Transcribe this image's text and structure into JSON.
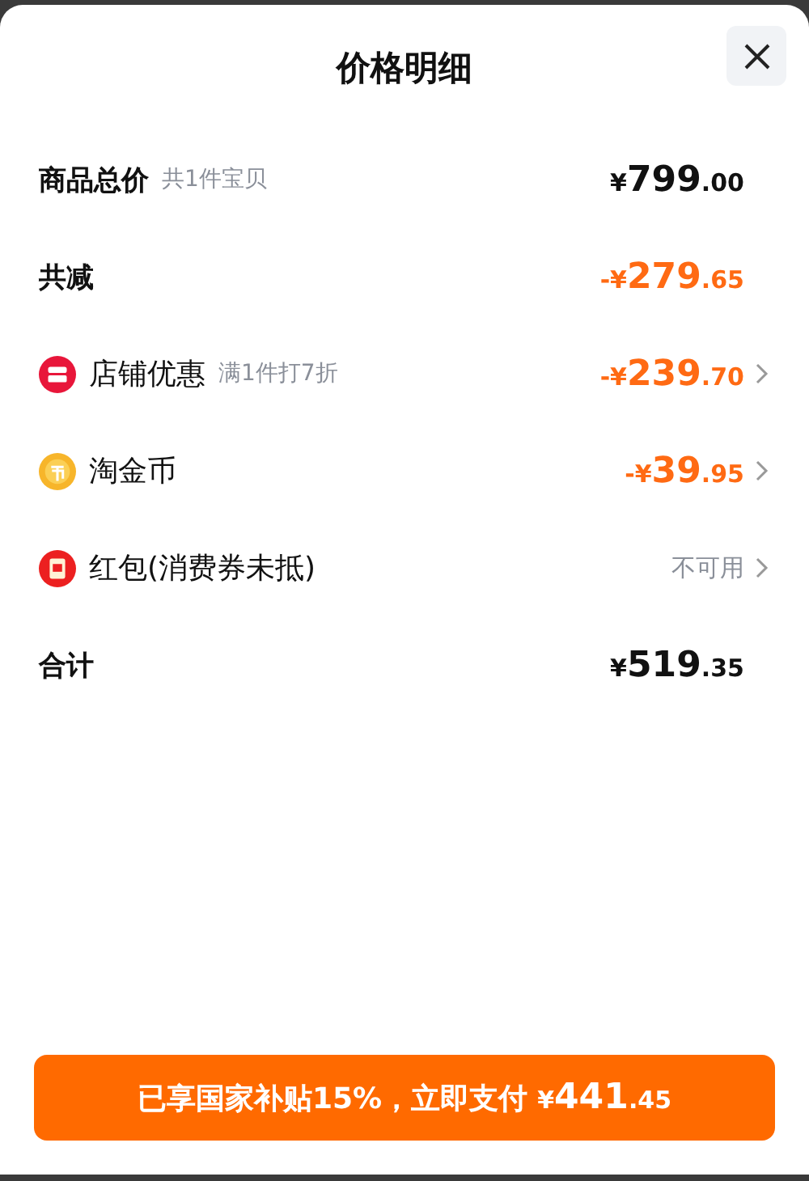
{
  "title": "价格明细",
  "rows": [
    {
      "kind": "heading",
      "label": "商品总价",
      "note": "共1件宝贝",
      "amount": {
        "sign": "¥",
        "integer": "799",
        "decimal": ".00"
      },
      "discount": false
    },
    {
      "kind": "heading",
      "label": "共减",
      "amount": {
        "sign": "-¥",
        "integer": "279",
        "decimal": ".65"
      },
      "discount": true
    },
    {
      "kind": "shop",
      "label": "店铺优惠",
      "note": "满1件打7折",
      "amount": {
        "sign": "-¥",
        "integer": "239",
        "decimal": ".70"
      },
      "discount": true,
      "has_arrow": true
    },
    {
      "kind": "coin",
      "label": "淘金币",
      "amount": {
        "sign": "-¥",
        "integer": "39",
        "decimal": ".95"
      },
      "discount": true,
      "has_arrow": true
    },
    {
      "kind": "envelope",
      "label": "红包(消费券未抵)",
      "status": "不可用",
      "has_arrow": true
    },
    {
      "kind": "heading",
      "label": "合计",
      "amount": {
        "sign": "¥",
        "integer": "519",
        "decimal": ".35"
      },
      "discount": false
    }
  ],
  "pay_button": {
    "label": "已享国家补贴15%，立即支付",
    "amount": {
      "sign": "¥",
      "integer": "441",
      "decimal": ".45"
    }
  }
}
